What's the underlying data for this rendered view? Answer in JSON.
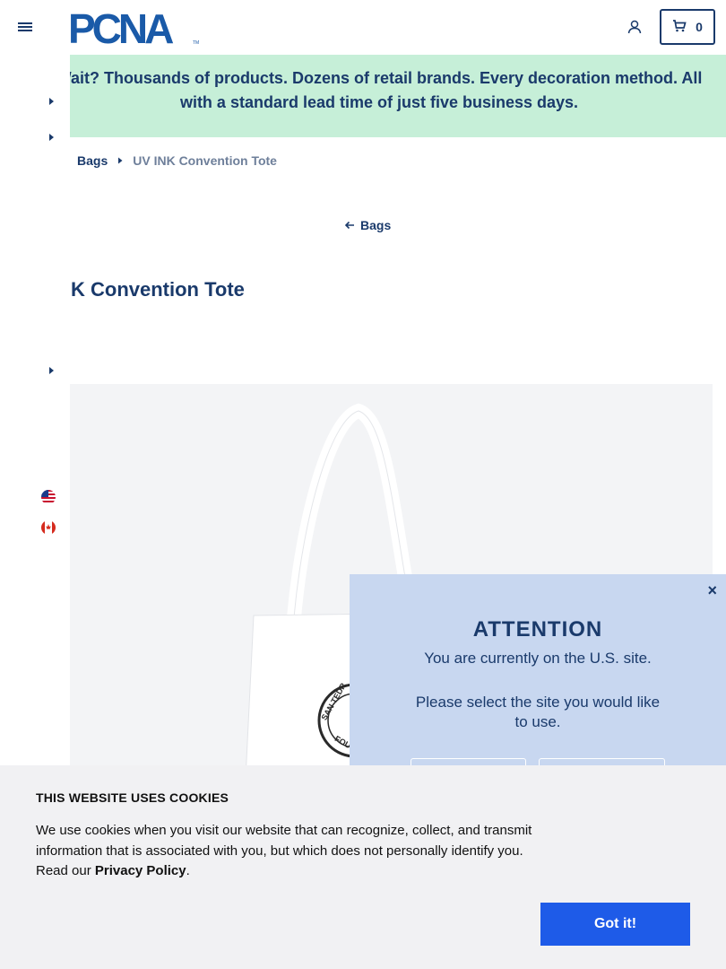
{
  "header": {
    "logo_text": "PCNA",
    "logo_tm": "TM",
    "cart_count": "0"
  },
  "promo": {
    "text": "Wait? Thousands of products. Dozens of retail brands. Every decoration method. All with a standard lead time of just five business days."
  },
  "breadcrumb": {
    "parent": "Bags",
    "current": "UV INK Convention Tote"
  },
  "back_link": "Bags",
  "product": {
    "title": "K Convention Tote",
    "print_text": "SAN TEDR",
    "print_text2": "FOU"
  },
  "modal": {
    "close": "×",
    "title": "ATTENTION",
    "line1": "You are currently on the U.S. site.",
    "line2": "Please select the site you would like to use."
  },
  "cookie": {
    "title": "THIS WEBSITE USES COOKIES",
    "body": "We use cookies when you visit our website that can recognize, collect, and transmit information that is associated with you, but which does not personally identify you. Read our ",
    "link": "Privacy Policy",
    "period": ".",
    "button": "Got it!"
  },
  "colors": {
    "brand": "#1a3a6b",
    "promo_bg": "#c6efd8",
    "modal_bg": "#c8d7f0",
    "cookie_button": "#1e5be8"
  },
  "icons": [
    "menu-icon",
    "user-icon",
    "cart-icon",
    "caret-right-icon",
    "arrow-left-icon",
    "us-flag-icon",
    "ca-flag-icon",
    "close-icon"
  ]
}
